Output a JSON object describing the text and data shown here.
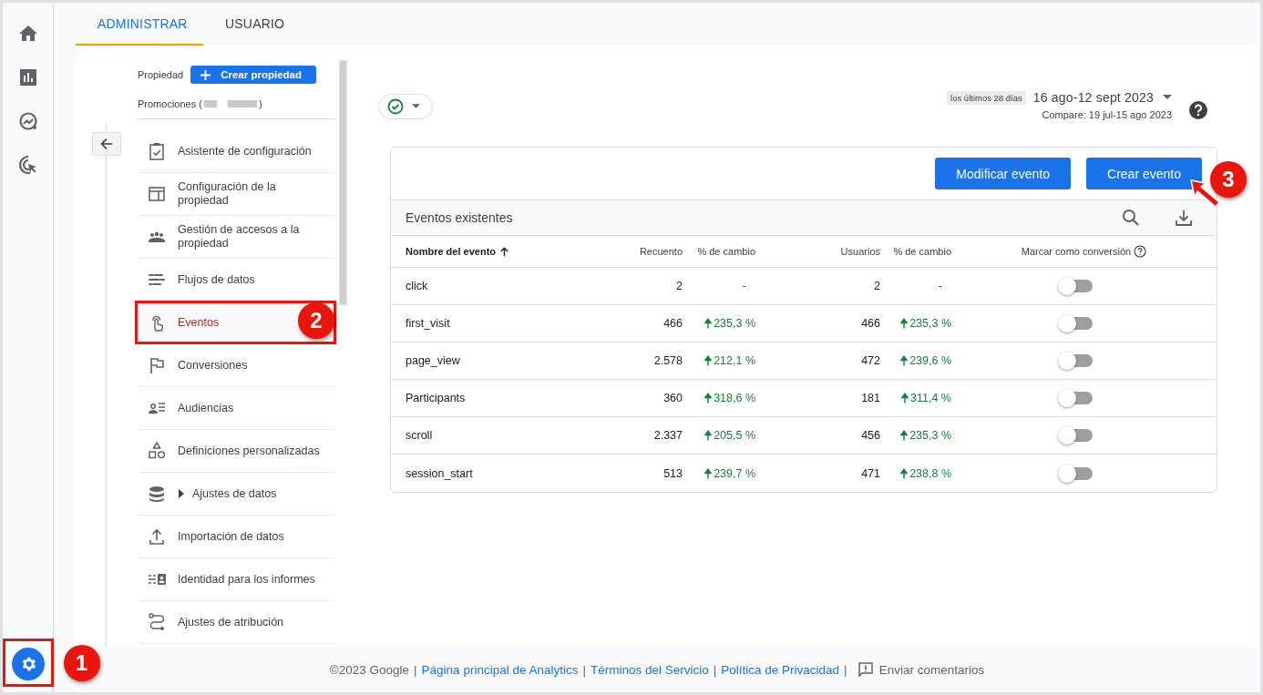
{
  "tabs": [
    {
      "label": "ADMINISTRAR",
      "selected": true
    },
    {
      "label": "USUARIO",
      "selected": false
    }
  ],
  "property": {
    "label": "Propiedad",
    "create_button": "Crear propiedad",
    "name_prefix": "Promociones (",
    "name_suffix": ")"
  },
  "nav_items": [
    {
      "label": "Asistente de configuración",
      "selected": false
    },
    {
      "label": "Configuración de la propiedad",
      "selected": false
    },
    {
      "label": "Gestión de accesos a la propiedad",
      "selected": false
    },
    {
      "label": "Flujos de datos",
      "selected": false
    },
    {
      "label": "Eventos",
      "selected": true
    },
    {
      "label": "Conversiones",
      "selected": false
    },
    {
      "label": "Audiencias",
      "selected": false
    },
    {
      "label": "Definiciones personalizadas",
      "selected": false
    },
    {
      "label": "Ajustes de datos",
      "selected": false,
      "expanded": false
    },
    {
      "label": "Importación de datos",
      "selected": false
    },
    {
      "label": "Identidad para los informes",
      "selected": false
    },
    {
      "label": "Ajustes de atribución",
      "selected": false
    }
  ],
  "date_range": {
    "preset": "los últimos 28 días",
    "range": "16 ago-12 sept 2023",
    "compare": "Compare: 19 jul-15 ago 2023"
  },
  "card": {
    "buttons": [
      "Modificar evento",
      "Crear evento"
    ],
    "title": "Eventos existentes",
    "columns": [
      {
        "label": "Nombre del evento",
        "sorted": true
      },
      {
        "label": "Recuento",
        "sorted": false
      },
      {
        "label": "% de cambio",
        "sorted": false
      },
      {
        "label": "Usuarios",
        "sorted": false
      },
      {
        "label": "% de cambio",
        "sorted": false
      },
      {
        "label": "Marcar como conversión",
        "sorted": false
      }
    ],
    "rows": [
      {
        "name": "click",
        "count": "2",
        "count_change": {
          "text": "-"
        },
        "users": "2",
        "users_change": {
          "text": "-"
        },
        "conversion": false
      },
      {
        "name": "first_visit",
        "count": "466",
        "count_change": {
          "text": "235,3 %",
          "increase": true
        },
        "users": "466",
        "users_change": {
          "text": "235,3 %",
          "increase": true
        },
        "conversion": false
      },
      {
        "name": "page_view",
        "count": "2.578",
        "count_change": {
          "text": "212,1 %",
          "increase": true
        },
        "users": "472",
        "users_change": {
          "text": "239,6 %",
          "increase": true
        },
        "conversion": false
      },
      {
        "name": "Participants",
        "count": "360",
        "count_change": {
          "text": "318,6 %",
          "increase": true
        },
        "users": "181",
        "users_change": {
          "text": "311,4 %",
          "increase": true
        },
        "conversion": false
      },
      {
        "name": "scroll",
        "count": "2.337",
        "count_change": {
          "text": "205,5 %",
          "increase": true
        },
        "users": "456",
        "users_change": {
          "text": "235,3 %",
          "increase": true
        },
        "conversion": false
      },
      {
        "name": "session_start",
        "count": "513",
        "count_change": {
          "text": "239,7 %",
          "increase": true
        },
        "users": "471",
        "users_change": {
          "text": "238,8 %",
          "increase": true
        },
        "conversion": false
      }
    ]
  },
  "footer": [
    {
      "kind": "text",
      "text": "©2023 Google"
    },
    {
      "kind": "separator",
      "text": "|"
    },
    {
      "kind": "link",
      "text": "Página principal de Analytics"
    },
    {
      "kind": "separator",
      "text": "|"
    },
    {
      "kind": "link",
      "text": "Términos del Servicio"
    },
    {
      "kind": "separator",
      "text": "|"
    },
    {
      "kind": "link",
      "text": "Política de Privacidad"
    },
    {
      "kind": "separator",
      "text": "|"
    },
    {
      "kind": "feedback",
      "text": "Enviar comentarios"
    }
  ],
  "annotations": [
    {
      "label": "1"
    },
    {
      "label": "2"
    },
    {
      "label": "3"
    }
  ]
}
